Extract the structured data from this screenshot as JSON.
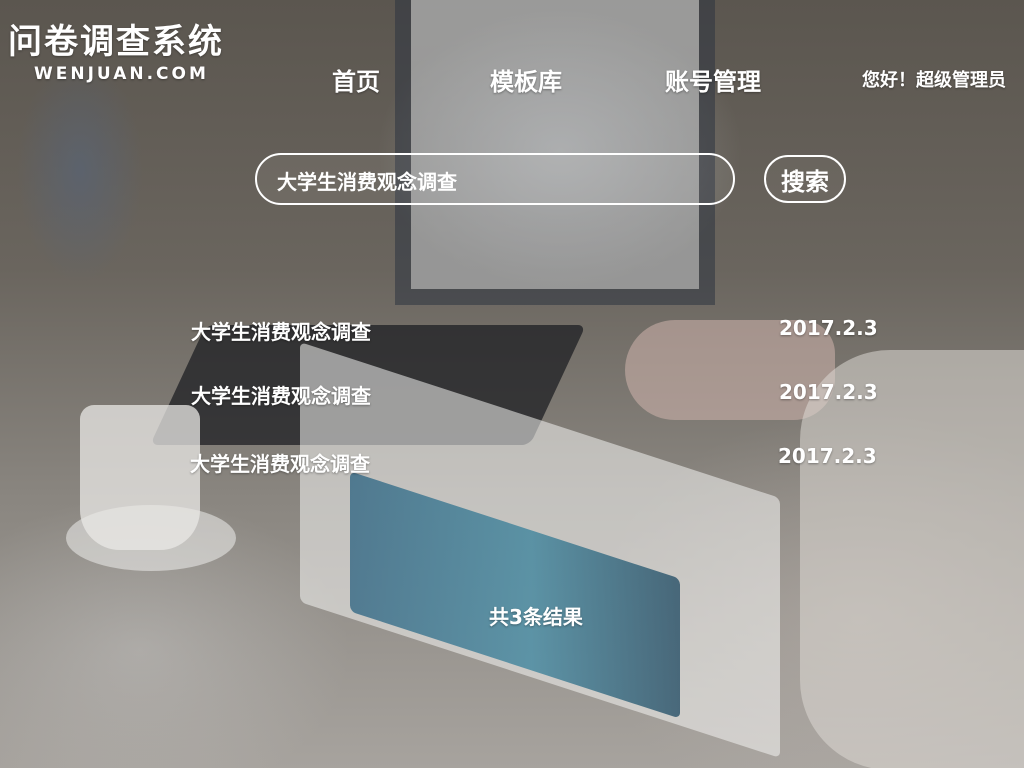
{
  "brand": {
    "title": "问卷调查系统",
    "subtitle": "WENJUAN.COM"
  },
  "nav": {
    "items": [
      {
        "label": "首页"
      },
      {
        "label": "模板库"
      },
      {
        "label": "账号管理"
      }
    ]
  },
  "user": {
    "greeting": "您好！超级管理员"
  },
  "search": {
    "value": "大学生消费观念调查",
    "button_label": "搜索"
  },
  "results": {
    "items": [
      {
        "title": "大学生消费观念调查",
        "date": "2017.2.3"
      },
      {
        "title": "大学生消费观念调查",
        "date": "2017.2.3"
      },
      {
        "title": "大学生消费观念调查",
        "date": "2017.2.3"
      }
    ],
    "count_text": "共3条结果"
  }
}
